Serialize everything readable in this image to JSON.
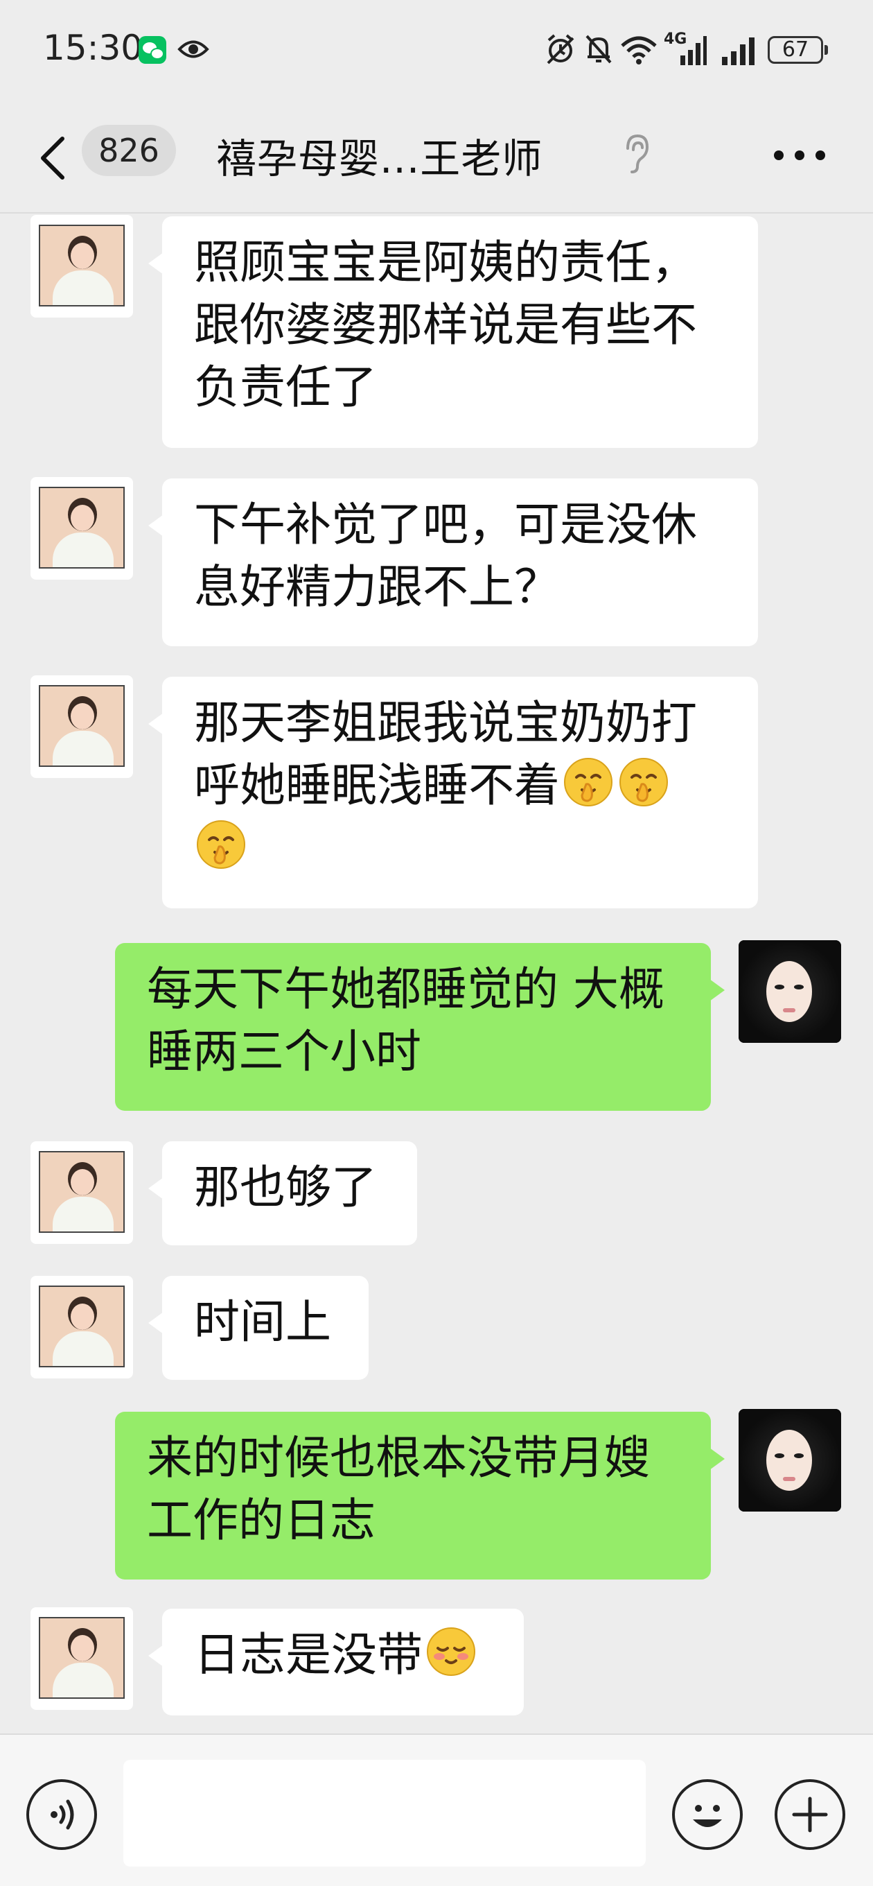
{
  "status_bar": {
    "time": "15:30",
    "network_label": "4G",
    "battery": "67",
    "icons": [
      "wechat-icon",
      "eye-icon",
      "alarm-icon",
      "bell-off-icon",
      "wifi-icon",
      "signal-icon",
      "signal-icon",
      "battery-icon"
    ]
  },
  "header": {
    "unread_count": "826",
    "title": "禧孕母婴...王老师",
    "icons": [
      "back-icon",
      "ear-icon",
      "more-icon"
    ]
  },
  "messages": [
    {
      "sender": "王老师",
      "side": "left",
      "lines": [
        "照顾宝宝是阿姨的责任，",
        "跟你婆婆那样说是有些不",
        "负责任了"
      ]
    },
    {
      "sender": "王老师",
      "side": "left",
      "lines": [
        "下午补觉了吧，可是没休",
        "息好精力跟不上？"
      ]
    },
    {
      "sender": "王老师",
      "side": "left",
      "lines": [
        "那天李姐跟我说宝奶奶打",
        "呼她睡眠浅睡不着"
      ],
      "emojis": [
        "shushing-face-emoji",
        "shushing-face-emoji",
        "shushing-face-emoji"
      ]
    },
    {
      "sender": "me",
      "side": "right",
      "lines": [
        "每天下午她都睡觉的 大概",
        "睡两三个小时"
      ]
    },
    {
      "sender": "王老师",
      "side": "left",
      "lines": [
        "那也够了"
      ]
    },
    {
      "sender": "王老师",
      "side": "left",
      "lines": [
        "时间上"
      ]
    },
    {
      "sender": "me",
      "side": "right",
      "lines": [
        "来的时候也根本没带月嫂",
        "工作的日志"
      ]
    },
    {
      "sender": "王老师",
      "side": "left",
      "lines": [
        "日志是没带"
      ],
      "emojis": [
        "blushing-face-emoji"
      ]
    }
  ],
  "input_bar": {
    "placeholder": "",
    "icons": [
      "voice-icon",
      "emoji-icon",
      "plus-icon"
    ]
  },
  "colors": {
    "background": "#ededed",
    "bubble_mine": "#95ec69",
    "bubble_theirs": "#ffffff",
    "wechat_green": "#07c160"
  }
}
